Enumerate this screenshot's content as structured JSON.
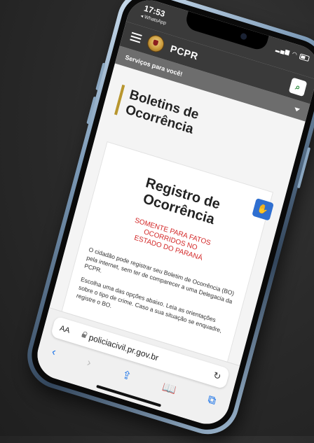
{
  "status": {
    "time": "17:53",
    "back_app": "◂ WhatsApp"
  },
  "header": {
    "brand": "PCPR",
    "services_label": "Serviços para você!"
  },
  "page": {
    "title_line1": "Boletins de",
    "title_line2": "Ocorrência"
  },
  "card": {
    "title_line1": "Registro de",
    "title_line2": "Ocorrência",
    "warning_line1": "SOMENTE PARA FATOS",
    "warning_line2": "OCORRIDOS NO",
    "warning_line3": "ESTADO DO PARANÁ",
    "paragraph1": "O cidadão pode registrar seu Boletim de Ocorrência (BO) pela internet, sem ter de comparecer a uma Delegacia da PCPR.",
    "paragraph2": "Escolha uma das opções abaixo. Leia as orientações sobre o tipo de crime. Caso a sua situação se enquadre, registre o BO."
  },
  "browser": {
    "aa_label": "AA",
    "url": "policiacivil.pr.gov.br"
  },
  "colors": {
    "accent_gold": "#b8962e",
    "warning_red": "#d32727",
    "link_blue": "#1a73e8",
    "search_green": "#2a8a3c"
  }
}
